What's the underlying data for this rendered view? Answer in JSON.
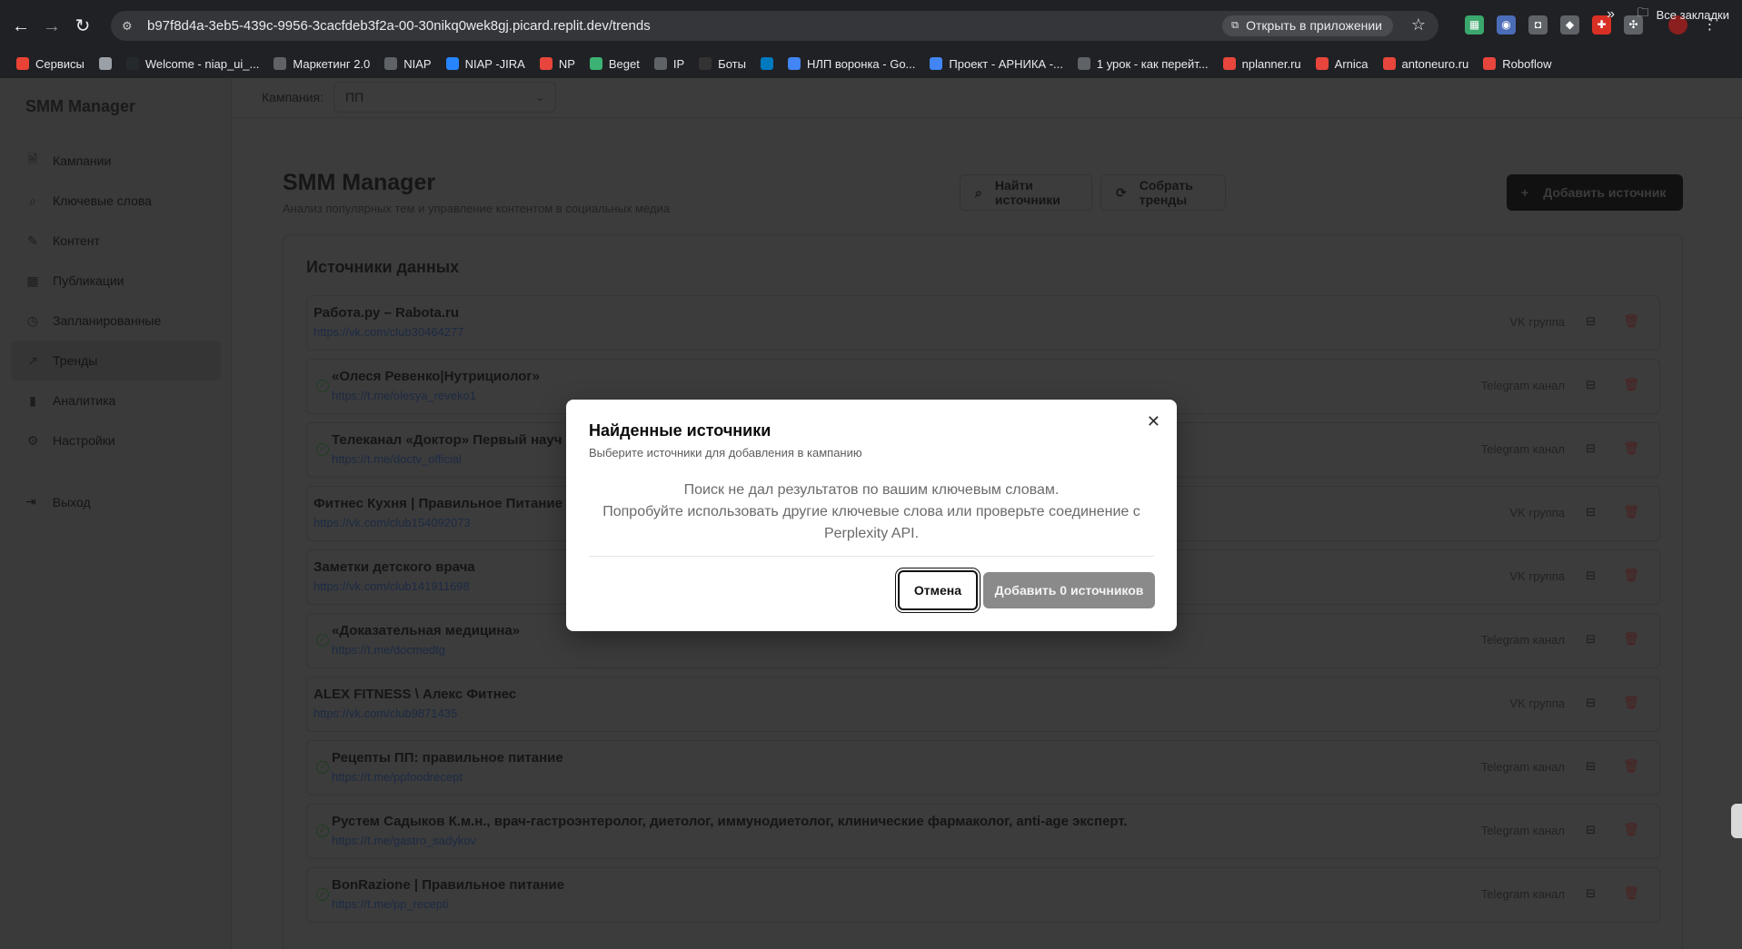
{
  "browser": {
    "url": "b97f8d4a-3eb5-439c-9956-3cacfdeb3f2a-00-30nikq0wek8gj.picard.replit.dev/trends",
    "open_in_app": "Открыть в приложении",
    "bookmarks": [
      {
        "label": "Сервисы",
        "color": "#ea4335"
      },
      {
        "label": "",
        "color": "#9aa0a6"
      },
      {
        "label": "Welcome - niap_ui_...",
        "color": "#24292e"
      },
      {
        "label": "Маркетинг 2.0",
        "color": "#5f6368"
      },
      {
        "label": "NIAP",
        "color": "#5f6368"
      },
      {
        "label": "NIAP -JIRA",
        "color": "#2684ff"
      },
      {
        "label": "NP",
        "color": "#e8453c"
      },
      {
        "label": "Beget",
        "color": "#3bb273"
      },
      {
        "label": "IP",
        "color": "#5f6368"
      },
      {
        "label": "Боты",
        "color": "#333333"
      },
      {
        "label": "",
        "color": "#0079bf"
      },
      {
        "label": "НЛП воронка - Go...",
        "color": "#4285f4"
      },
      {
        "label": "Проект - АРНИКА -...",
        "color": "#4285f4"
      },
      {
        "label": "1 урок - как перейт...",
        "color": "#5f6368"
      },
      {
        "label": "nplanner.ru",
        "color": "#e8453c"
      },
      {
        "label": "Arnica",
        "color": "#e8453c"
      },
      {
        "label": "antoneuro.ru",
        "color": "#e8453c"
      },
      {
        "label": "Roboflow",
        "color": "#e8453c"
      }
    ],
    "all_bookmarks": "Все закладки"
  },
  "sidebar": {
    "brand": "SMM Manager",
    "items": [
      {
        "label": "Кампании",
        "icon": "document-icon"
      },
      {
        "label": "Ключевые слова",
        "icon": "search-icon"
      },
      {
        "label": "Контент",
        "icon": "brush-icon"
      },
      {
        "label": "Публикации",
        "icon": "calendar-icon"
      },
      {
        "label": "Запланированные",
        "icon": "clock-icon"
      },
      {
        "label": "Тренды",
        "icon": "trending-icon"
      },
      {
        "label": "Аналитика",
        "icon": "bar-chart-icon"
      },
      {
        "label": "Настройки",
        "icon": "gear-icon"
      }
    ],
    "logout": "Выход"
  },
  "topbar": {
    "campaign_label": "Кампания:",
    "campaign_value": "ПП"
  },
  "header": {
    "title": "SMM Manager",
    "subtitle": "Анализ популярных тем и управление контентом в социальных медиа",
    "find_sources": "Найти источники",
    "collect_trends": "Собрать тренды",
    "add_source": "Добавить источник"
  },
  "sources": {
    "title": "Источники данных",
    "items": [
      {
        "name": "Работа.ру – Rabota.ru",
        "url": "https://vk.com/club30464277",
        "type": "VK группа",
        "checked": false
      },
      {
        "name": "«Олеся Ревенко|Нутрициолог»",
        "url": "https://t.me/olesya_reveko1",
        "type": "Telegram канал",
        "checked": true
      },
      {
        "name": "Телеканал «Доктор» Первый науч",
        "url": "https://t.me/doctv_official",
        "type": "Telegram канал",
        "checked": true
      },
      {
        "name": "Фитнес Кухня | Правильное Питание",
        "url": "https://vk.com/club154092073",
        "type": "VK группа",
        "checked": false
      },
      {
        "name": "Заметки детского врача",
        "url": "https://vk.com/club141911698",
        "type": "VK группа",
        "checked": false
      },
      {
        "name": "«Доказательная медицина»",
        "url": "https://t.me/docmedtg",
        "type": "Telegram канал",
        "checked": true
      },
      {
        "name": "ALEX FITNESS \\ Алекс Фитнес",
        "url": "https://vk.com/club9871435",
        "type": "VK группа",
        "checked": false
      },
      {
        "name": "Рецепты ПП: правильное питание",
        "url": "https://t.me/ppfoodrecept",
        "type": "Telegram канал",
        "checked": true
      },
      {
        "name": "Рустем Садыков К.м.н., врач-гастроэнтеролог, диетолог, иммунодиетолог, клинические фармаколог, anti-age эксперт.",
        "url": "https://t.me/gastro_sadykov",
        "type": "Telegram канал",
        "checked": true
      },
      {
        "name": "BonRazione | Правильное питание",
        "url": "https://t.me/pp_recepti",
        "type": "Telegram канал",
        "checked": true
      }
    ]
  },
  "modal": {
    "title": "Найденные источники",
    "subtitle": "Выберите источники для добавления в кампанию",
    "body_line1": "Поиск не дал результатов по вашим ключевым словам.",
    "body_line2": "Попробуйте использовать другие ключевые слова или проверьте соединение с Perplexity API.",
    "cancel": "Отмена",
    "add": "Добавить 0 источников"
  }
}
